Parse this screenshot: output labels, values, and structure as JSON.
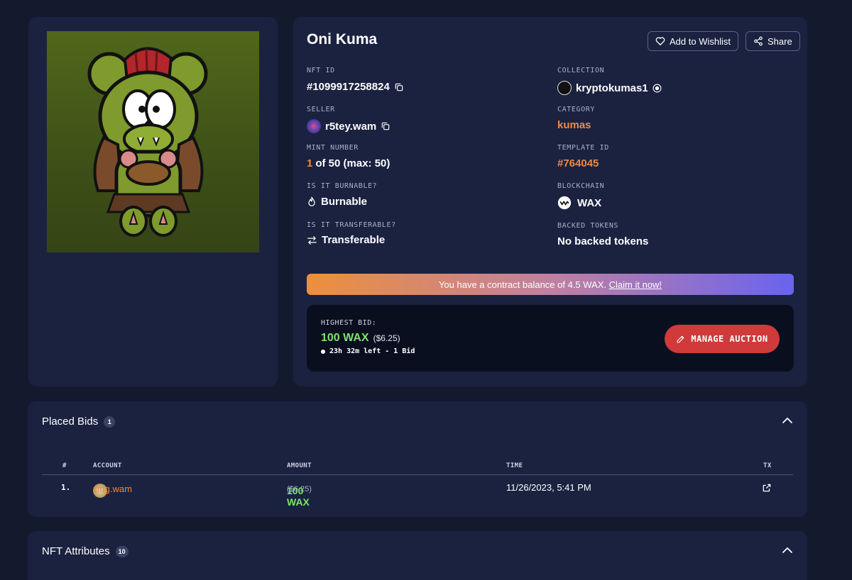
{
  "nft": {
    "title": "Oni Kuma",
    "wishlist_label": "Add to Wishlist",
    "share_label": "Share"
  },
  "fields": {
    "nft_id_label": "NFT ID",
    "nft_id": "#1099917258824",
    "seller_label": "SELLER",
    "seller": "r5tey.wam",
    "mint_label": "MINT NUMBER",
    "mint_number": "1",
    "mint_rest": "of 50 (max: 50)",
    "burnable_label": "IS IT BURNABLE?",
    "burnable": "Burnable",
    "transferable_label": "IS IT TRANSFERABLE?",
    "transferable": "Transferable",
    "collection_label": "COLLECTION",
    "collection": "kryptokumas1",
    "category_label": "CATEGORY",
    "category": "kumas",
    "template_label": "TEMPLATE ID",
    "template_id": "#764045",
    "blockchain_label": "BLOCKCHAIN",
    "blockchain": "WAX",
    "backed_label": "BACKED TOKENS",
    "backed": "No backed tokens"
  },
  "banner": {
    "text": "You have a contract balance of 4.5 WAX.",
    "link": "Claim it now!"
  },
  "auction": {
    "highest_bid_label": "HIGHEST BID:",
    "amount": "100 WAX",
    "usd": "($6.25)",
    "time_left": "23h 32m left - 1 Bid",
    "manage_label": "MANAGE AUCTION"
  },
  "bids": {
    "title": "Placed Bids",
    "count": "1",
    "columns": [
      "#",
      "ACCOUNT",
      "AMOUNT",
      "TIME",
      "TX"
    ],
    "rows": [
      {
        "index": "1.",
        "account": "zlttg.wam",
        "amount": "100 WAX",
        "usd": "($6.25)",
        "time": "11/26/2023, 5:41 PM"
      }
    ]
  },
  "attributes": {
    "title": "NFT Attributes",
    "count": "10"
  },
  "colors": {
    "background": "#141a2e",
    "card": "#1b2240",
    "accent_orange": "#f0883e",
    "accent_green": "#7ee36a",
    "button_red": "#d03a3a"
  }
}
